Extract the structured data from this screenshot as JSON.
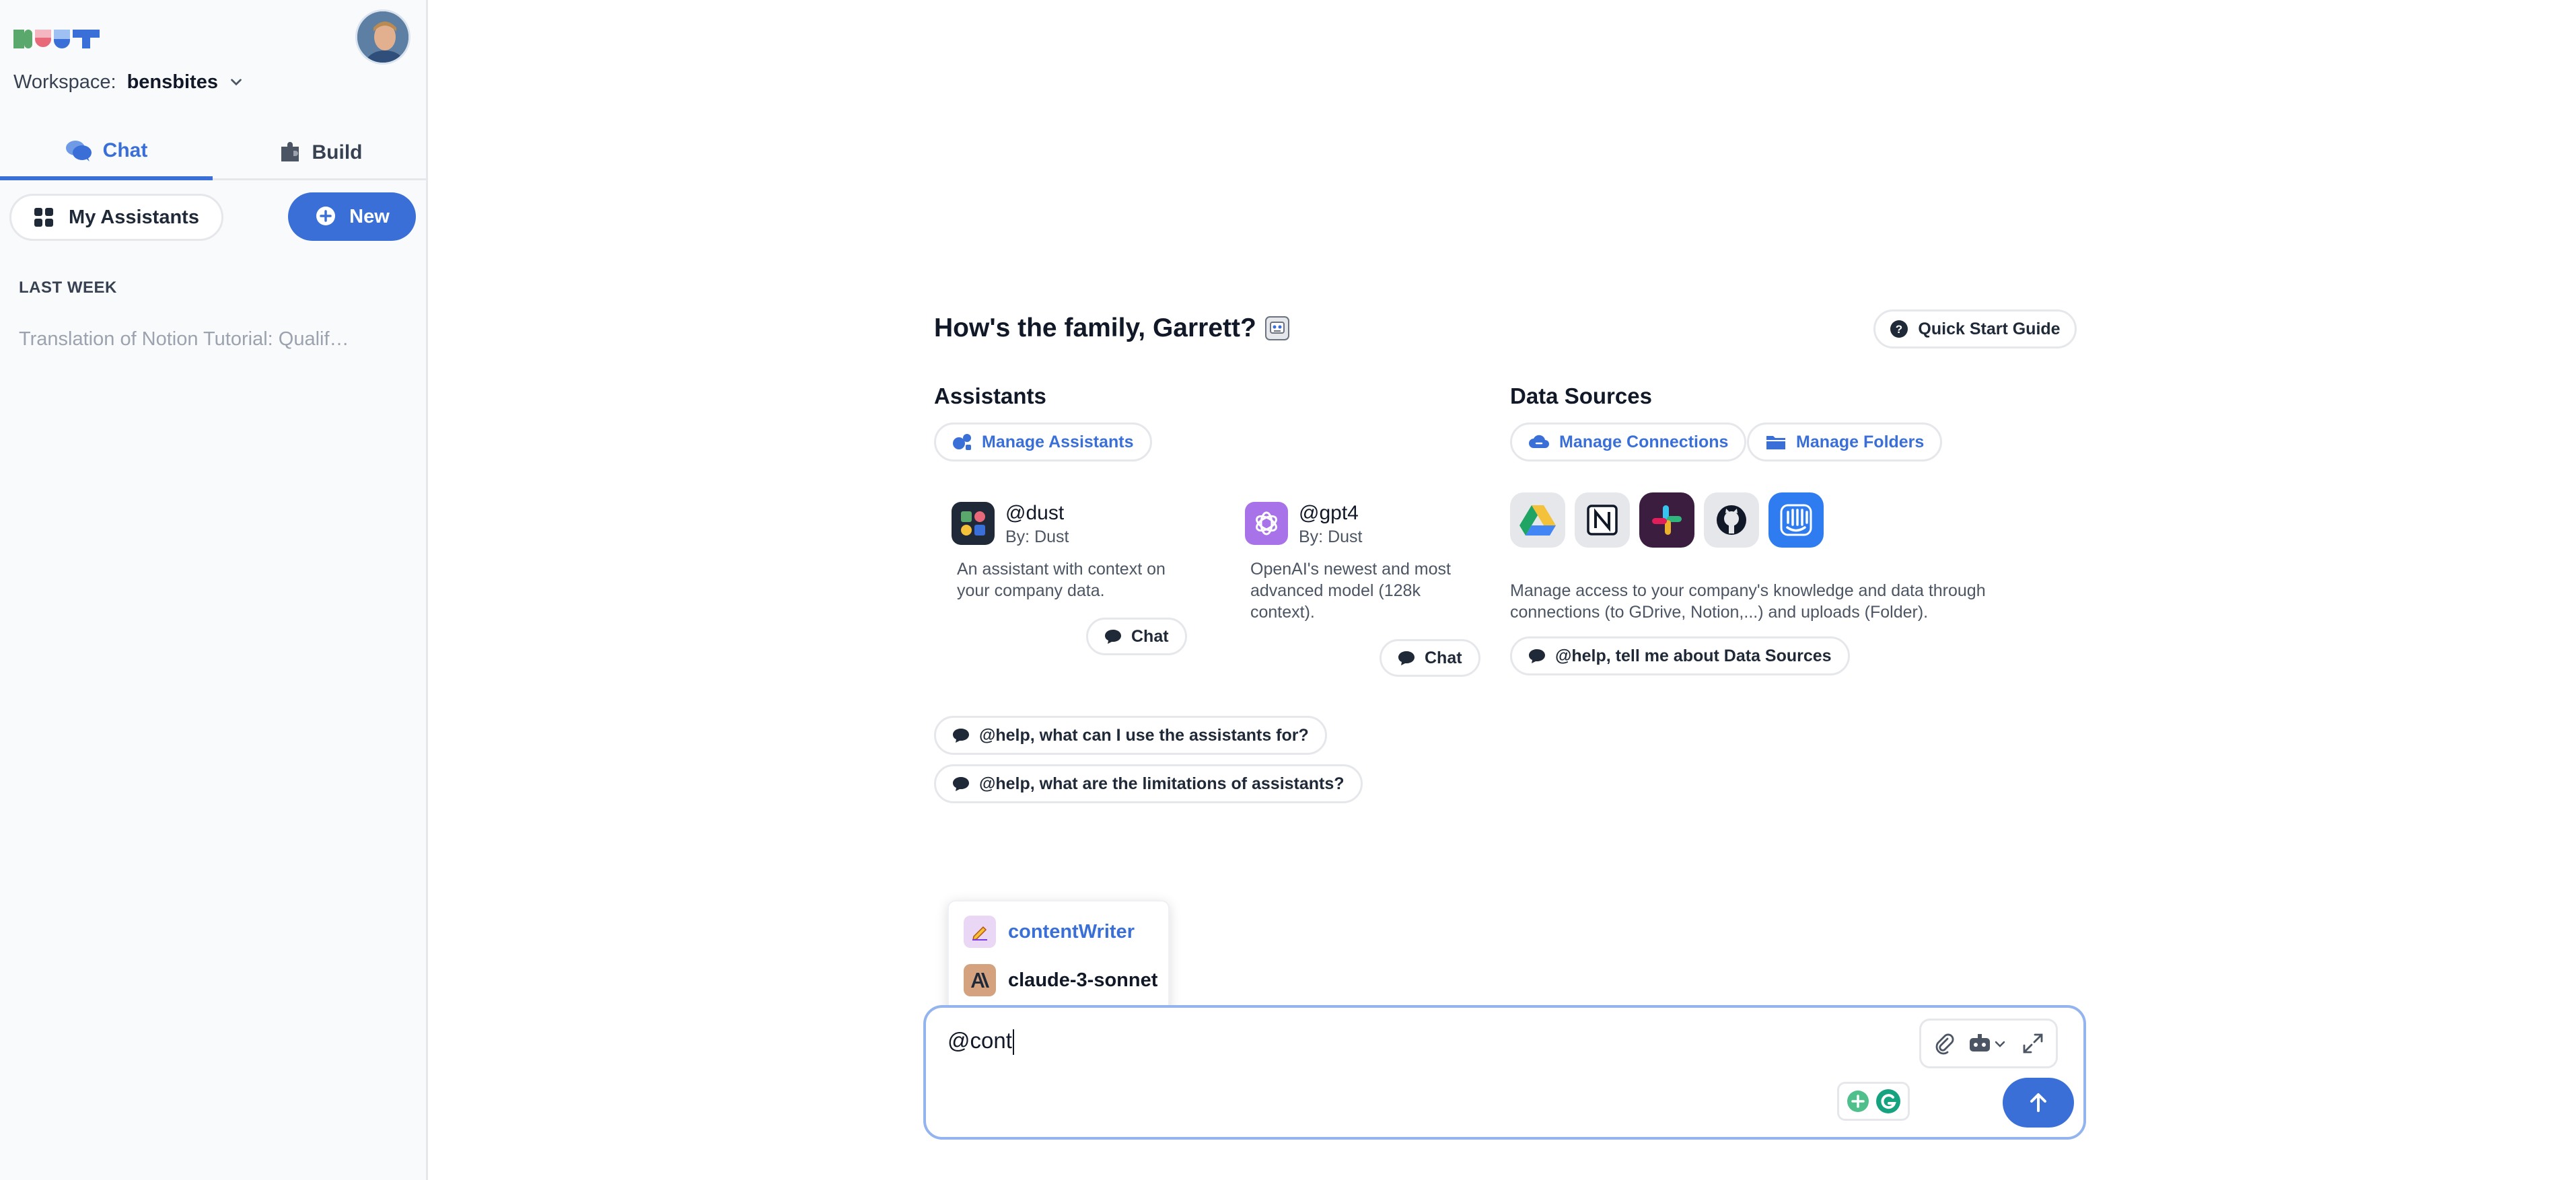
{
  "sidebar": {
    "workspace_label": "Workspace:",
    "workspace_name": "bensbites",
    "tabs": [
      {
        "label": "Chat",
        "active": true
      },
      {
        "label": "Build",
        "active": false
      }
    ],
    "my_assistants_label": "My Assistants",
    "new_label": "New",
    "section_label": "LAST WEEK",
    "conversations": [
      "Translation of Notion Tutorial: Qualif…"
    ]
  },
  "main": {
    "greeting": "How's the family, Garrett?",
    "quick_start_label": "Quick Start Guide",
    "assistants": {
      "heading": "Assistants",
      "manage_label": "Manage Assistants",
      "cards": [
        {
          "name": "@dust",
          "by": "By: Dust",
          "description": "An assistant with context on your company data.",
          "chat_label": "Chat"
        },
        {
          "name": "@gpt4",
          "by": "By: Dust",
          "description": "OpenAI's newest and most advanced model (128k context).",
          "chat_label": "Chat"
        }
      ],
      "help_prompts": [
        "@help, what can I use the assistants for?",
        "@help, what are the limitations of assistants?"
      ]
    },
    "data_sources": {
      "heading": "Data Sources",
      "manage_connections_label": "Manage Connections",
      "manage_folders_label": "Manage Folders",
      "connectors": [
        "google-drive-icon",
        "notion-icon",
        "slack-icon",
        "github-icon",
        "intercom-icon"
      ],
      "description": "Manage access to your company's knowledge and data through connections (to GDrive, Notion,...) and uploads (Folder).",
      "help_prompt": "@help, tell me about Data Sources"
    }
  },
  "mention_popup": {
    "items": [
      {
        "label": "contentWriter",
        "highlighted": true
      },
      {
        "label": "claude-3-sonnet",
        "highlighted": false
      }
    ]
  },
  "input": {
    "value": "@cont"
  },
  "colors": {
    "accent": "#3b6fd8",
    "sidebar_bg": "#f8fafc",
    "input_border": "#93b4ee"
  }
}
